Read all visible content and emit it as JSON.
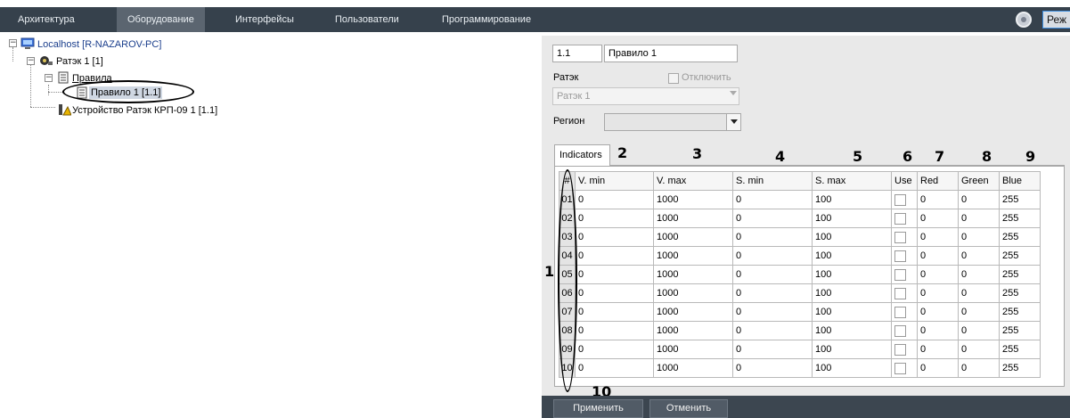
{
  "toolbar": {
    "tabs": [
      "Архитектура",
      "Оборудование",
      "Интерфейсы",
      "Пользователи",
      "Программирование"
    ],
    "active_tab": "Оборудование",
    "mode_label": "Реж"
  },
  "tree": {
    "host": "Localhost [R-NAZAROV-PC]",
    "device": "Ратэк 1 [1]",
    "rules_folder": "Правила",
    "rule": "Правило 1 [1.1]",
    "subdevice": "Устройство Ратэк КРП-09 1 [1.1]"
  },
  "props": {
    "id": "1.1",
    "name": "Правило 1",
    "ratek_label": "Ратэк",
    "disable_label": "Отключить",
    "ratek_value": "Ратэк 1",
    "region_label": "Регион",
    "region_value": ""
  },
  "grid": {
    "tab_label": "Indicators",
    "columns": [
      "#",
      "V. min",
      "V. max",
      "S. min",
      "S. max",
      "Use",
      "Red",
      "Green",
      "Blue"
    ],
    "rows": [
      [
        "01",
        "0",
        "1000",
        "0",
        "100",
        false,
        "0",
        "0",
        "255"
      ],
      [
        "02",
        "0",
        "1000",
        "0",
        "100",
        false,
        "0",
        "0",
        "255"
      ],
      [
        "03",
        "0",
        "1000",
        "0",
        "100",
        false,
        "0",
        "0",
        "255"
      ],
      [
        "04",
        "0",
        "1000",
        "0",
        "100",
        false,
        "0",
        "0",
        "255"
      ],
      [
        "05",
        "0",
        "1000",
        "0",
        "100",
        false,
        "0",
        "0",
        "255"
      ],
      [
        "06",
        "0",
        "1000",
        "0",
        "100",
        false,
        "0",
        "0",
        "255"
      ],
      [
        "07",
        "0",
        "1000",
        "0",
        "100",
        false,
        "0",
        "0",
        "255"
      ],
      [
        "08",
        "0",
        "1000",
        "0",
        "100",
        false,
        "0",
        "0",
        "255"
      ],
      [
        "09",
        "0",
        "1000",
        "0",
        "100",
        false,
        "0",
        "0",
        "255"
      ],
      [
        "10",
        "0",
        "1000",
        "0",
        "100",
        false,
        "0",
        "0",
        "255"
      ]
    ]
  },
  "callouts": [
    "1",
    "2",
    "3",
    "4",
    "5",
    "6",
    "7",
    "8",
    "9",
    "10"
  ],
  "buttons": {
    "apply": "Применить",
    "cancel": "Отменить"
  },
  "colors": {
    "toolbar_bg": "#36414c",
    "active_tab_bg": "#5b6570",
    "panel_bg": "#e9e9e9",
    "bottom_bar_bg": "#3c4650"
  }
}
